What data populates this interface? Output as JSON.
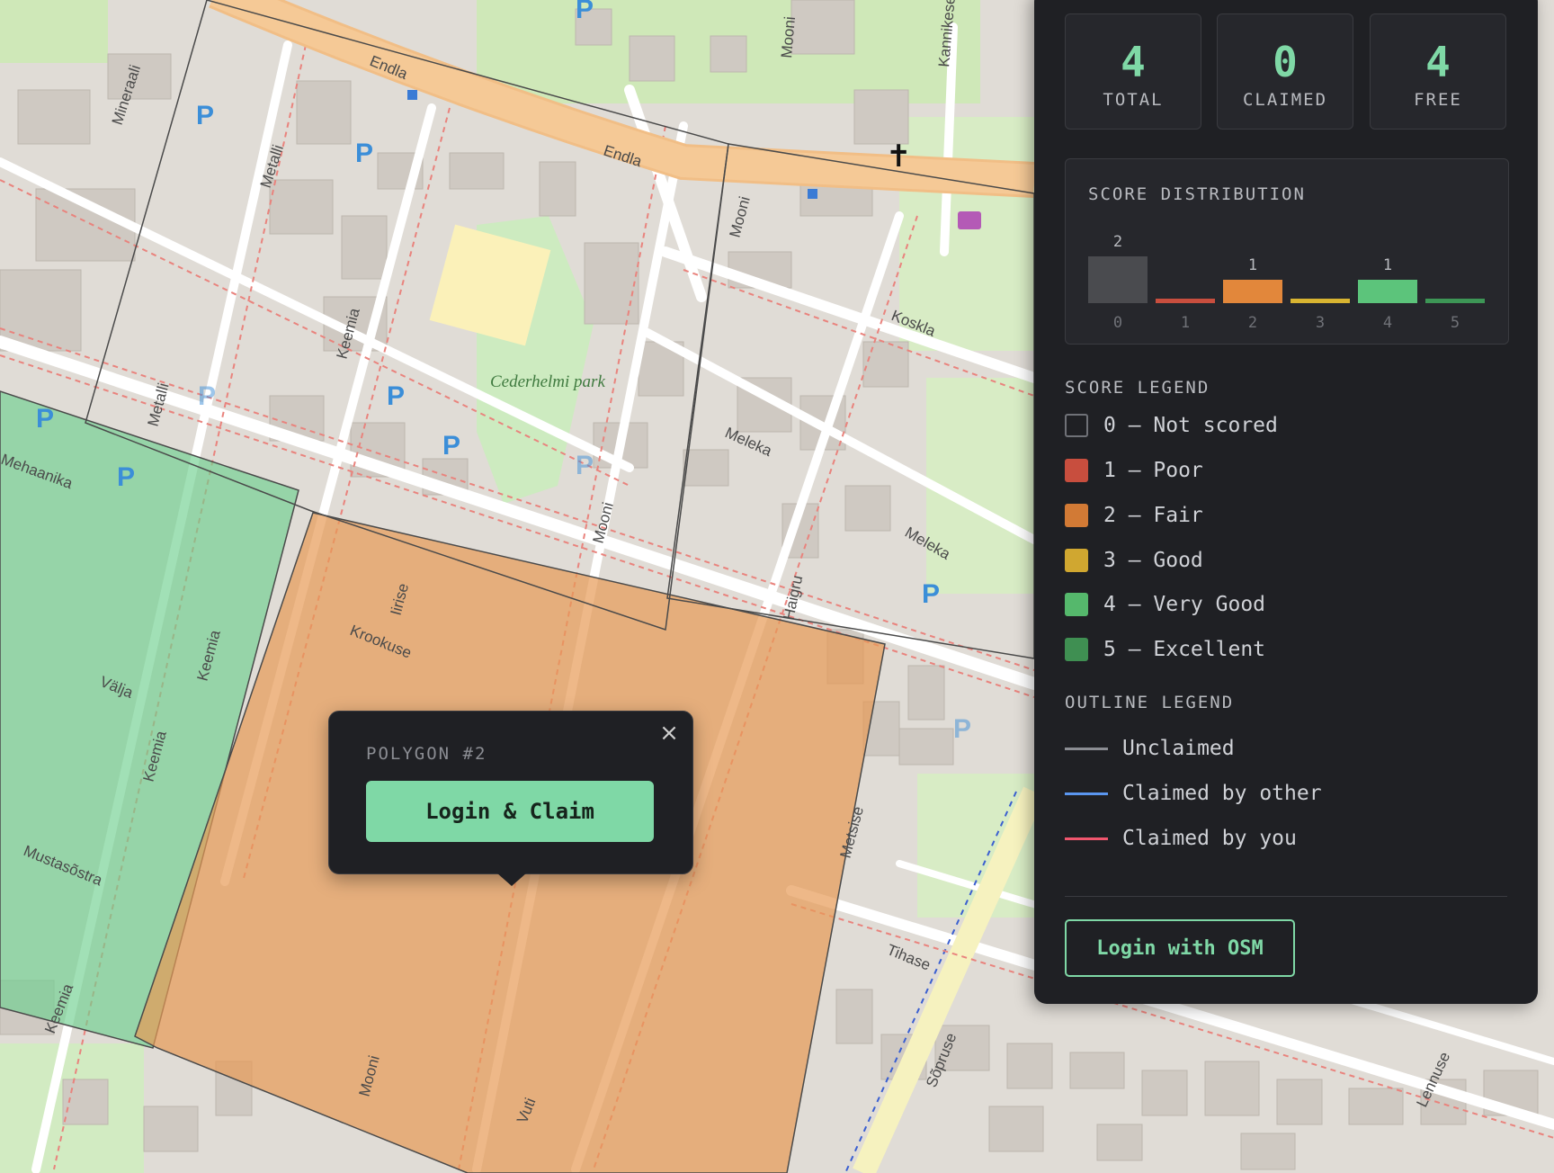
{
  "map": {
    "streets": [
      "Endla",
      "Endla",
      "Mineraali",
      "Metalli",
      "Metalli",
      "Keemia",
      "Mooni",
      "Mooni",
      "Kannikese",
      "Koskla",
      "Meleka",
      "Meleka",
      "Mooni",
      "Haigru",
      "Iirise",
      "Krookuse",
      "Keemia",
      "Keemia",
      "Välja",
      "Mehaanika",
      "Mustasõstra",
      "Keemia",
      "Metsise",
      "Tihase",
      "Sõpruse",
      "Lennuse",
      "Mooni",
      "Vuti"
    ],
    "park_name": "Cederhelmi park",
    "parking_symbol": "P",
    "colors": {
      "water_polygon_green": "#6fd08f",
      "polygon_orange": "#e79a55",
      "outline": "#4a4a4a"
    }
  },
  "popup": {
    "title": "POLYGON #2",
    "claim_label": "Login & Claim",
    "close_icon": "×"
  },
  "panel": {
    "stats": [
      {
        "value": "4",
        "label": "TOTAL"
      },
      {
        "value": "0",
        "label": "CLAIMED"
      },
      {
        "value": "4",
        "label": "FREE"
      }
    ],
    "distribution": {
      "title": "SCORE DISTRIBUTION",
      "bars": [
        {
          "score": "0",
          "count": "2",
          "value": 2,
          "color": "#4a4b4f"
        },
        {
          "score": "1",
          "count": "",
          "value": 0,
          "color": "#c84e3e"
        },
        {
          "score": "2",
          "count": "1",
          "value": 1,
          "color": "#e2873b"
        },
        {
          "score": "3",
          "count": "",
          "value": 0,
          "color": "#d8b431"
        },
        {
          "score": "4",
          "count": "1",
          "value": 1,
          "color": "#5cc47b"
        },
        {
          "score": "5",
          "count": "",
          "value": 0,
          "color": "#3d9656"
        }
      ]
    },
    "score_legend": {
      "title": "SCORE LEGEND",
      "items": [
        {
          "label": "0 — Not scored",
          "color": ""
        },
        {
          "label": "1 — Poor",
          "color": "#c84e3e"
        },
        {
          "label": "2 — Fair",
          "color": "#d27a35"
        },
        {
          "label": "3 — Good",
          "color": "#d0a730"
        },
        {
          "label": "4 — Very Good",
          "color": "#55b86c"
        },
        {
          "label": "5 — Excellent",
          "color": "#3f8f52"
        }
      ]
    },
    "outline_legend": {
      "title": "OUTLINE LEGEND",
      "items": [
        {
          "label": "Unclaimed",
          "color": "#8b8d93"
        },
        {
          "label": "Claimed by other",
          "color": "#5a96f0"
        },
        {
          "label": "Claimed by you",
          "color": "#f0566e"
        }
      ]
    },
    "login_label": "Login with OSM"
  }
}
